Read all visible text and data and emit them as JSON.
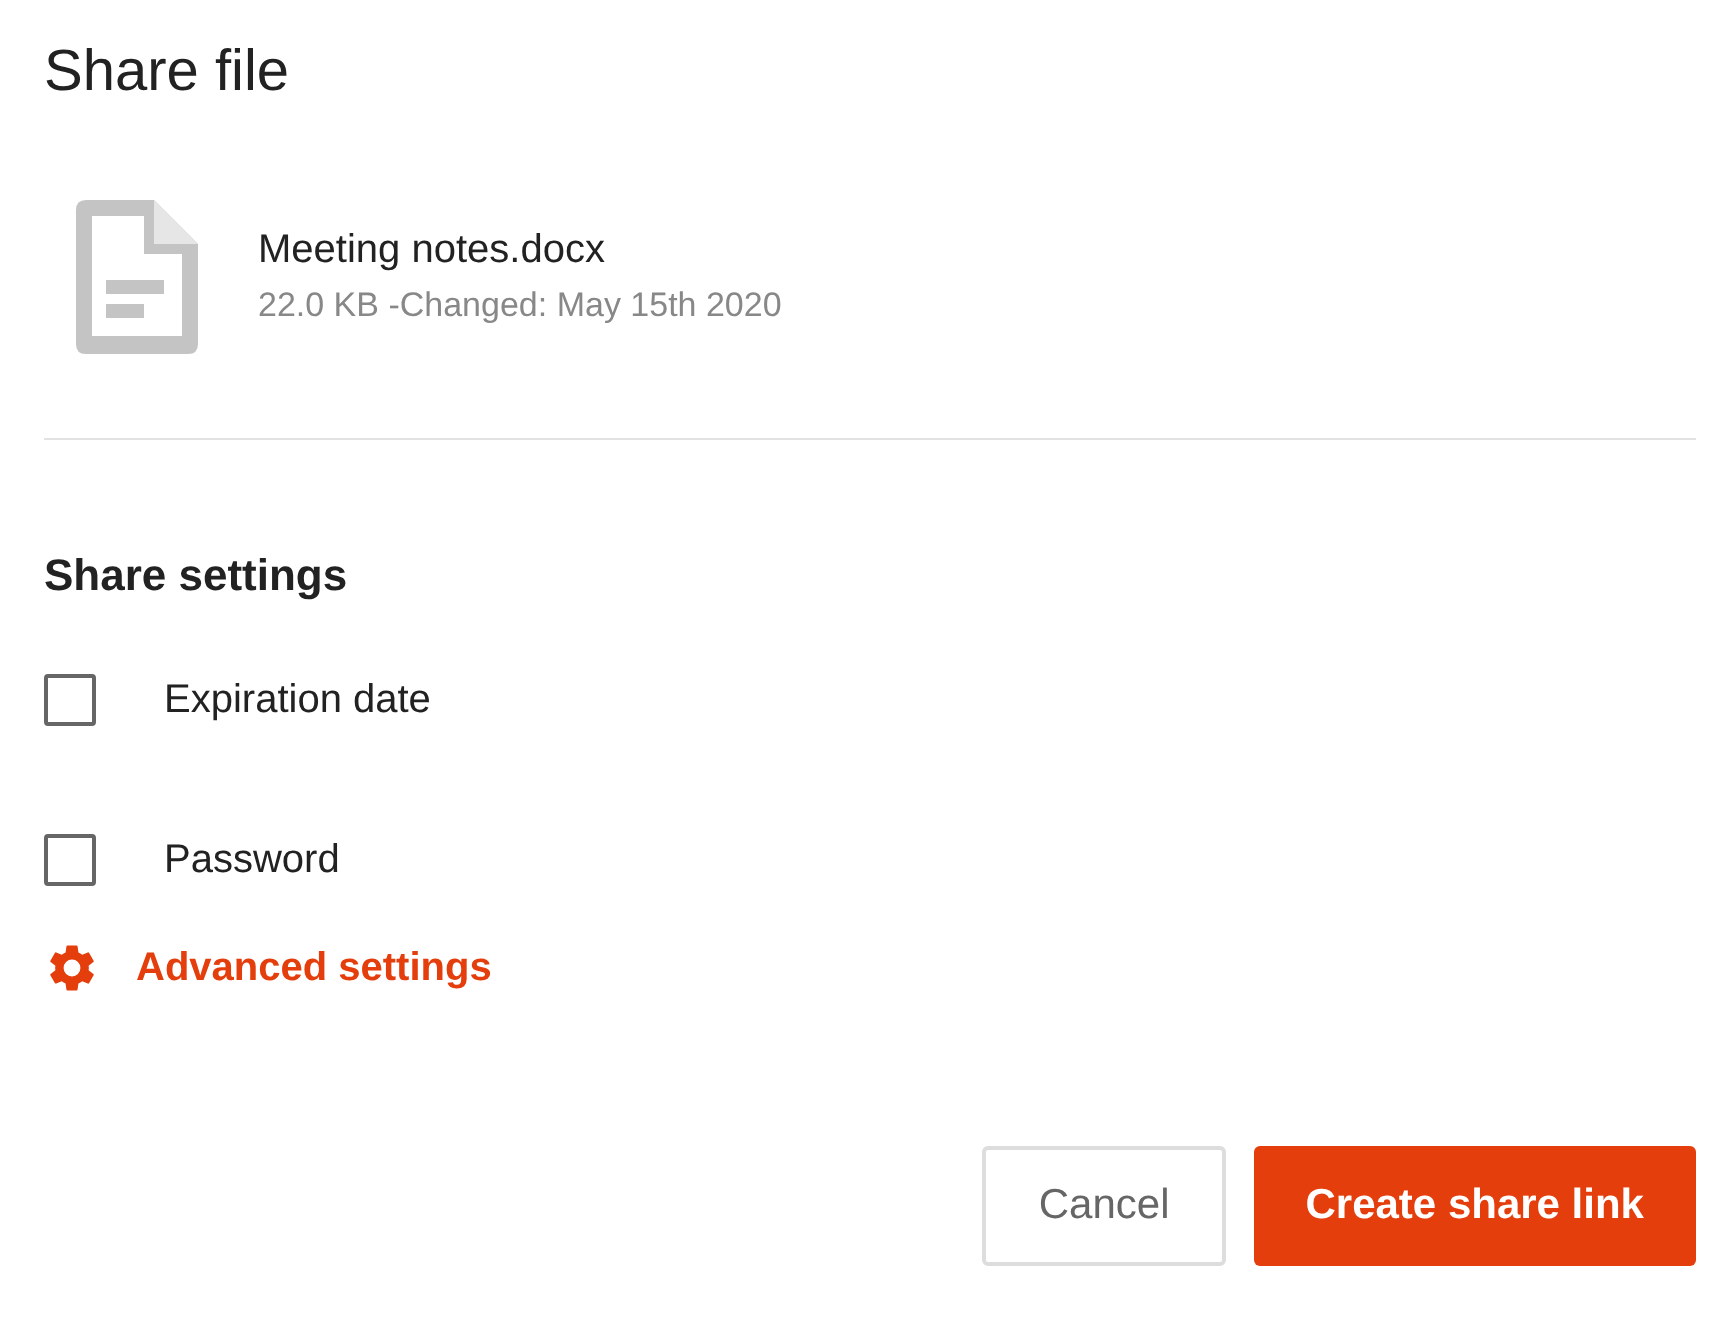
{
  "title": "Share file",
  "file": {
    "name": "Meeting notes.docx",
    "meta": "22.0 KB -Changed: May 15th 2020"
  },
  "settings": {
    "heading": "Share settings",
    "options": [
      {
        "label": "Expiration date",
        "checked": false
      },
      {
        "label": "Password",
        "checked": false
      }
    ],
    "advanced": "Advanced settings"
  },
  "buttons": [
    {
      "label": "Cancel",
      "kind": "secondary"
    },
    {
      "label": "Create share link",
      "kind": "primary"
    }
  ]
}
